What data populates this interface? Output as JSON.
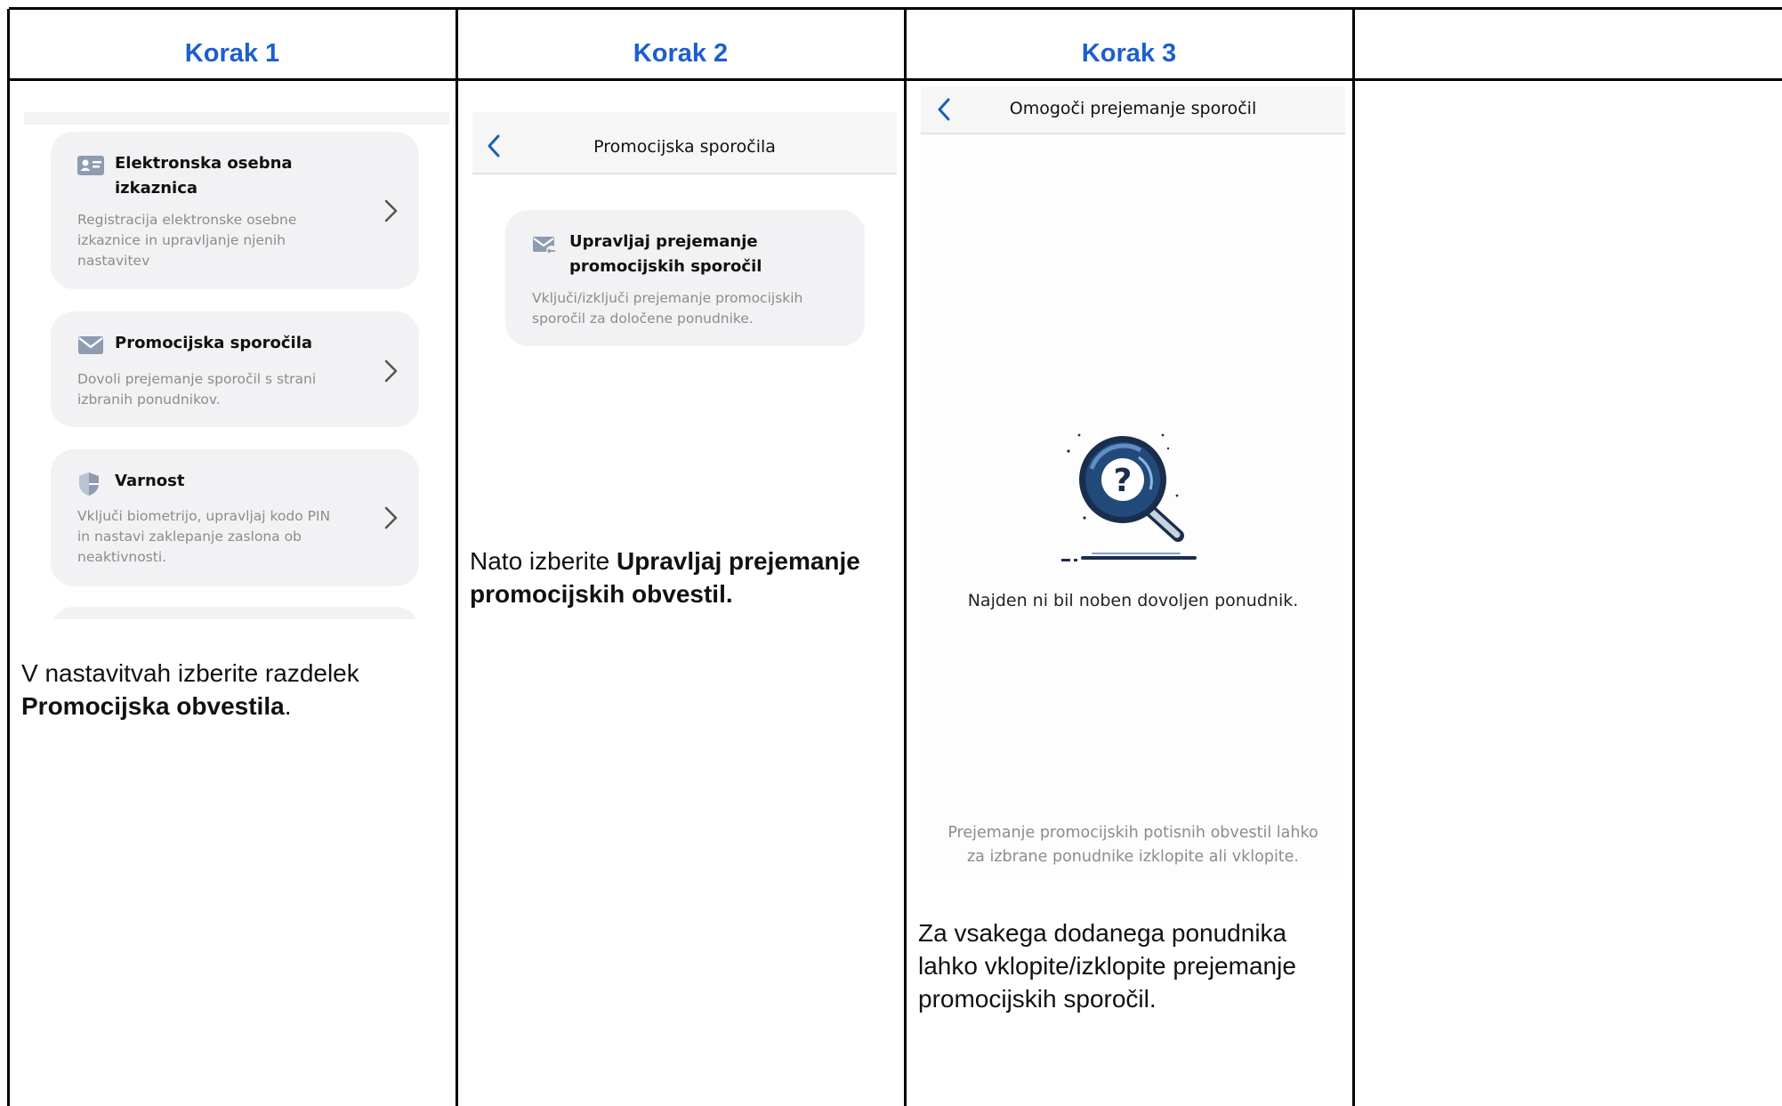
{
  "columns": [
    {
      "heading": "Korak 1"
    },
    {
      "heading": "Korak 2"
    },
    {
      "heading": "Korak 3"
    },
    {
      "heading": ""
    }
  ],
  "step1": {
    "cards": [
      {
        "icon": "id-card-icon",
        "title": "Elektronska osebna izkaznica",
        "description": "Registracija elektronske osebne izkaznice in upravljanje njenih nastavitev"
      },
      {
        "icon": "envelope-icon",
        "title": "Promocijska sporočila",
        "description": "Dovoli prejemanje sporočil s strani izbranih ponudnikov."
      },
      {
        "icon": "shield-icon",
        "title": "Varnost",
        "description": "Vključi biometrijo, upravljaj kodo PIN in nastavi zaklepanje zaslona ob neaktivnosti."
      }
    ],
    "caption_prefix": "V nastavitvah izberite razdelek",
    "caption_bold": "Promocijska obvestila",
    "caption_suffix": "."
  },
  "step2": {
    "nav_title": "Promocijska sporočila",
    "card": {
      "icon": "mail-settings-icon",
      "title": "Upravljaj prejemanje promocijskih sporočil",
      "description": "Vključi/izključi prejemanje promocijskih sporočil za določene ponudnike."
    },
    "caption_prefix": "Nato izberite",
    "caption_bold": "Upravljaj prejemanje promocijskih obvestil."
  },
  "step3": {
    "nav_title": "Omogoči prejemanje sporočil",
    "empty_text": "Najden ni bil noben dovoljen ponudnik.",
    "footer_text": "Prejemanje promocijskih potisnih obvestil lahko za izbrane ponudnike izklopite ali vklopite.",
    "caption": "Za vsakega dodanega ponudnika lahko vklopite/izklopite prejemanje promocijskih sporočil."
  },
  "colors": {
    "heading": "#1b5fce",
    "back_chevron": "#1a5fb4",
    "card_bg": "#f2f2f4",
    "icon_gray": "#8e9bb0"
  }
}
